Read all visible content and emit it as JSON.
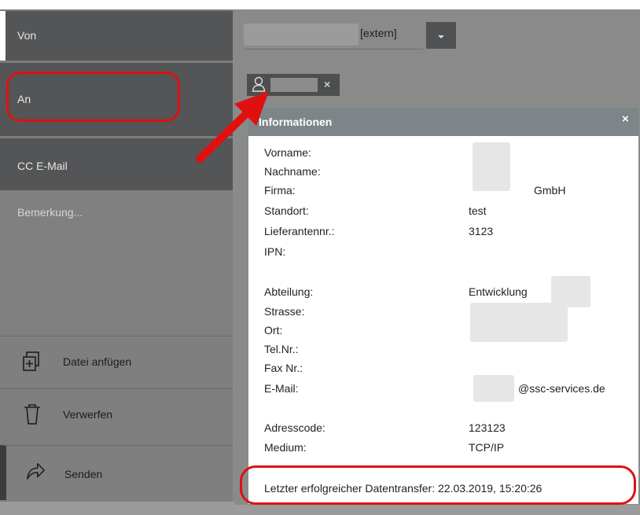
{
  "fields": {
    "von_label": "Von",
    "an_label": "An",
    "cc_label": "CC E-Mail",
    "remark_placeholder": "Bemerkung...",
    "from_suffix": "[extern]"
  },
  "actions": [
    {
      "label": "Datei anfügen",
      "icon": "attach-file-icon"
    },
    {
      "label": "Verwerfen",
      "icon": "trash-icon"
    },
    {
      "label": "Senden",
      "icon": "share-send-icon"
    }
  ],
  "recipient_chip": {
    "icon": "person-icon",
    "remove": "×"
  },
  "popup": {
    "title": "Informationen",
    "close": "×",
    "labels": {
      "vorname": "Vorname:",
      "nachname": "Nachname:",
      "firma": "Firma:",
      "standort": "Standort:",
      "lieferantennr": "Lieferantennr.:",
      "ipn": "IPN:",
      "abteilung": "Abteilung:",
      "strasse": "Strasse:",
      "ort": "Ort:",
      "telnr": "Tel.Nr.:",
      "faxnr": "Fax Nr.:",
      "email": "E-Mail:",
      "adresscode": "Adresscode:",
      "medium": "Medium:"
    },
    "values": {
      "firma": "GmbH",
      "standort": "test",
      "lieferantennr": "3123",
      "abteilung": "Entwicklung",
      "email": "@ssc-services.de",
      "adresscode": "123123",
      "medium": "TCP/IP"
    },
    "last_transfer": "Letzter erfolgreicher Datentransfer: 22.03.2019, 15:20:26"
  },
  "colors": {
    "annotation_red": "#e01010",
    "popup_header": "#7e8589",
    "label_bar": "#545556"
  }
}
